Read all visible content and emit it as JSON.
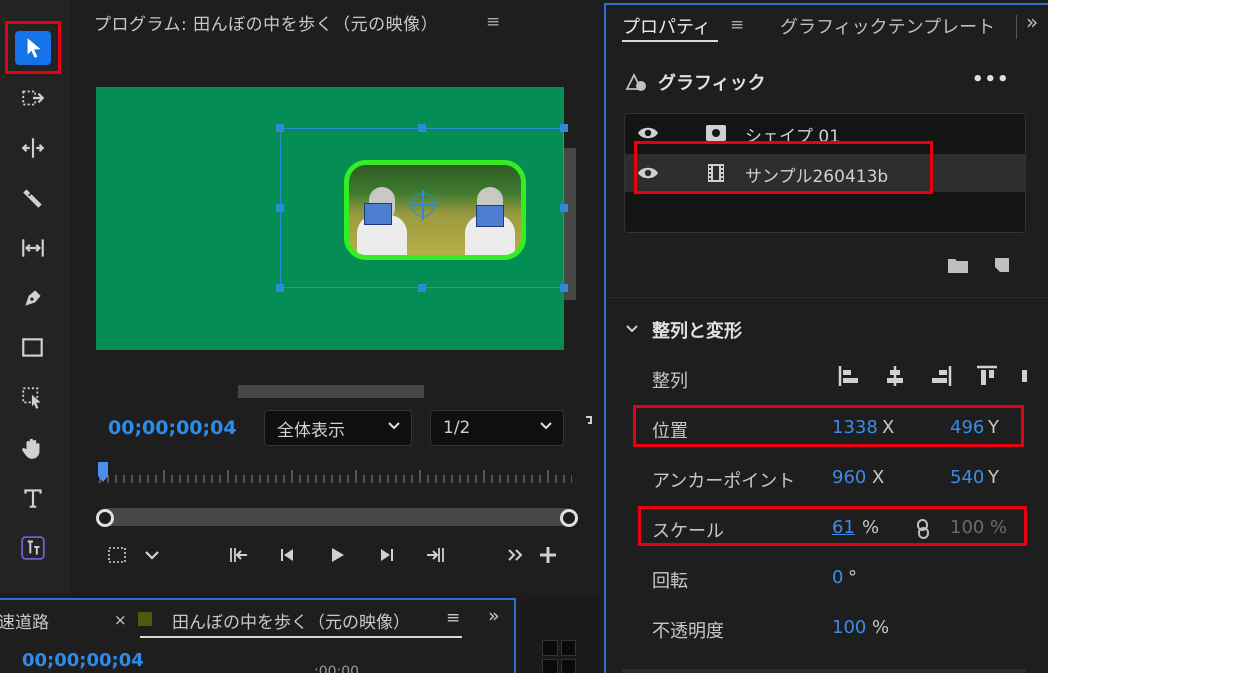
{
  "program_monitor": {
    "title": "プログラム: 田んぼの中を歩く（元の映像）",
    "menu_glyph": "≡",
    "timecode": "00;00;00;04",
    "zoom_select": "全体表示",
    "resolution_select": "1/2"
  },
  "properties": {
    "tab_active": "プロパティ",
    "tab_menu": "≡",
    "tab_inactive": "グラフィックテンプレート",
    "tab_more": "»",
    "graphic_section": "グラフィック",
    "graphic_more": "•••",
    "layers": [
      {
        "name": "シェイプ 01"
      },
      {
        "name": "サンプル260413b"
      }
    ],
    "transform_section": "整列と変形",
    "align_label": "整列",
    "position": {
      "label": "位置",
      "x": "1338",
      "x_unit": "X",
      "y": "496",
      "y_unit": "Y"
    },
    "anchor": {
      "label": "アンカーポイント",
      "x": "960",
      "x_unit": "X",
      "y": "540",
      "y_unit": "Y"
    },
    "scale": {
      "label": "スケール",
      "value": "61",
      "unit": "%",
      "locked_value": "100",
      "locked_unit": "%"
    },
    "rotation": {
      "label": "回転",
      "value": "0",
      "unit": "°"
    },
    "opacity": {
      "label": "不透明度",
      "value": "100",
      "unit": "%"
    }
  },
  "timeline": {
    "tab1": "速道路",
    "close": "×",
    "tab2": "田んぼの中を歩く（元の映像）",
    "menu_glyph": "≡",
    "more": "»",
    "timecode": "00;00;00;04",
    "ruler_label": ";00;00"
  },
  "colors": {
    "accent": "#2d8ceb",
    "selection_tool": "#1473e6",
    "highlight_box": "#e60012",
    "canvas_green": "#058e53",
    "clip_border": "#33ee22"
  }
}
